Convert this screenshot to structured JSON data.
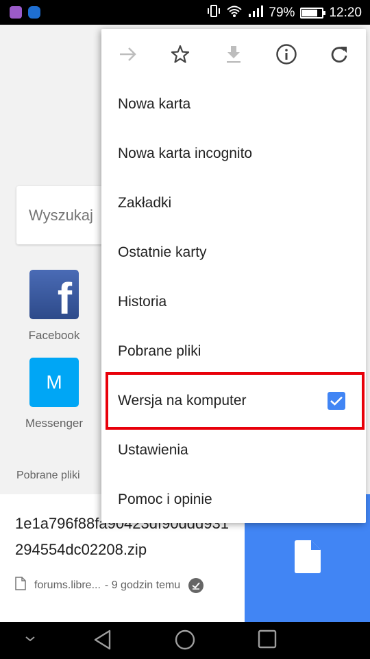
{
  "status_bar": {
    "battery_percent": "79%",
    "battery_level": 0.79,
    "time": "12:20",
    "icons": [
      "gallery-app-icon",
      "vpn-app-icon",
      "vibrate-icon",
      "wifi-icon",
      "signal-icon",
      "battery-icon"
    ]
  },
  "page": {
    "search_placeholder": "Wyszukaj",
    "tiles": [
      {
        "label": "Facebook",
        "glyph": "f",
        "color": "#3b5998"
      },
      {
        "label": "Messenger",
        "glyph": "M",
        "color": "#00a6f5"
      }
    ],
    "downloads_title": "Pobrane pliki",
    "download": {
      "filename": "1e1a796f88fa90423df90ddd931294554dc02208.zip",
      "source": "forums.libre...",
      "time_ago": "- 9 godzin temu",
      "thumb_color": "#4185f4"
    }
  },
  "menu": {
    "toolbar": [
      {
        "name": "forward-icon",
        "enabled": false
      },
      {
        "name": "bookmark-star-icon",
        "enabled": true
      },
      {
        "name": "download-icon",
        "enabled": false
      },
      {
        "name": "info-icon",
        "enabled": true
      },
      {
        "name": "reload-icon",
        "enabled": true
      }
    ],
    "items": [
      {
        "label": "Nowa karta"
      },
      {
        "label": "Nowa karta incognito"
      },
      {
        "label": "Zakładki"
      },
      {
        "label": "Ostatnie karty"
      },
      {
        "label": "Historia"
      },
      {
        "label": "Pobrane pliki"
      },
      {
        "label": "Wersja na komputer",
        "checked": true
      },
      {
        "label": "Ustawienia"
      },
      {
        "label": "Pomoc i opinie"
      }
    ],
    "checkbox_color": "#4185f4",
    "highlight_color": "#e8000a"
  },
  "nav_bar": {
    "buttons": [
      "hide-nav-icon",
      "back-icon",
      "home-icon",
      "recents-icon"
    ]
  }
}
